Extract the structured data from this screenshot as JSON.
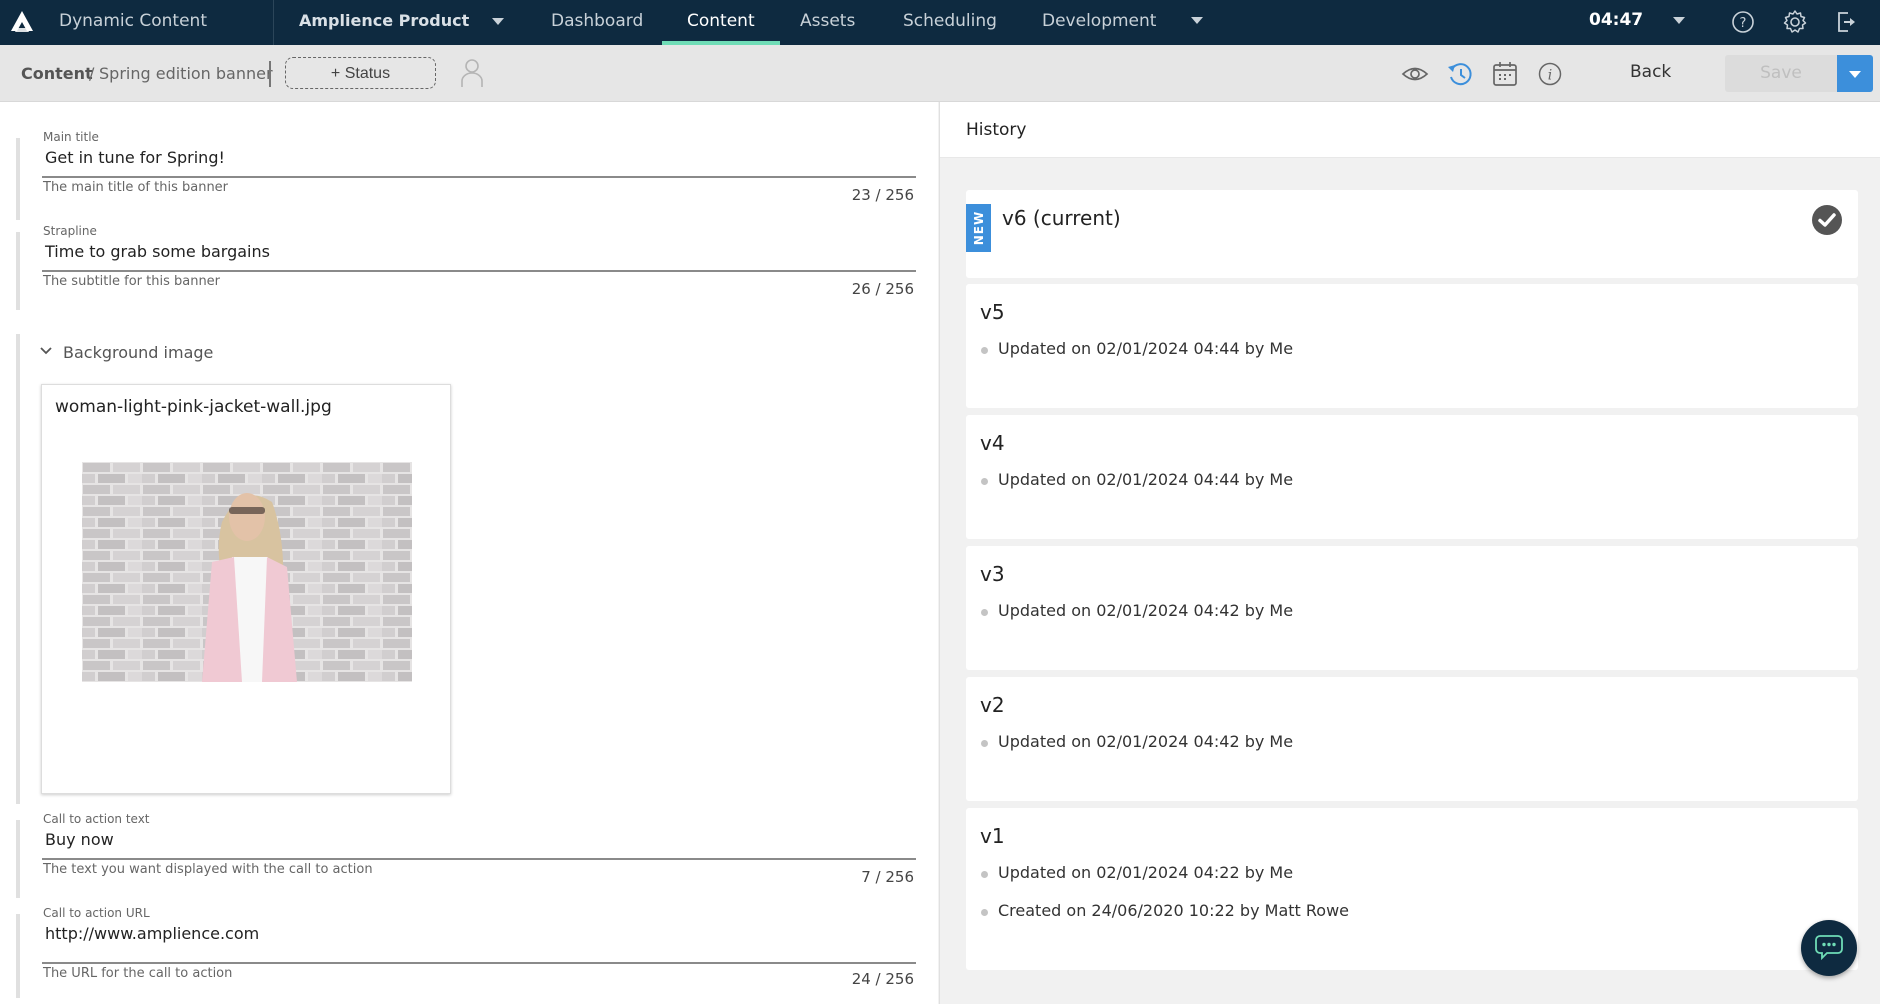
{
  "topnav": {
    "app_title": "Dynamic Content",
    "hub_name": "Amplience Product",
    "tabs": [
      {
        "label": "Dashboard",
        "active": false
      },
      {
        "label": "Content",
        "active": true
      },
      {
        "label": "Assets",
        "active": false
      },
      {
        "label": "Scheduling",
        "active": false
      },
      {
        "label": "Development",
        "active": false
      }
    ],
    "time": "04:47",
    "icons": [
      "help-icon",
      "settings-icon",
      "logout-icon"
    ],
    "accent_color": "#6fdcb6",
    "bg_color": "#0e2a40"
  },
  "toolbar": {
    "breadcrumb_root": "Content",
    "breadcrumb_sep": "/",
    "breadcrumb_current": "Spring edition banner",
    "status_label": "+ Status",
    "icons": [
      "preview-eye-icon",
      "history-icon",
      "calendar-icon",
      "info-icon"
    ],
    "active_icon": "history-icon",
    "back_label": "Back",
    "save_label": "Save",
    "save_enabled": false,
    "primary_color": "#3c8fdb"
  },
  "editor": {
    "fields": [
      {
        "label": "Main title",
        "value": "Get in tune for Spring!",
        "help": "The main title of this banner",
        "count": "23 / 256"
      },
      {
        "label": "Strapline",
        "value": "Time to grab some bargains",
        "help": "The subtitle for this banner",
        "count": "26 / 256"
      },
      {
        "label": "Call to action text",
        "value": "Buy now",
        "help": "The text you want displayed with the call to action",
        "count": "7 / 256"
      },
      {
        "label": "Call to action URL",
        "value": "http://www.amplience.com",
        "help": "The URL for the call to action",
        "count": "24 / 256"
      }
    ],
    "background_image": {
      "section_title": "Background image",
      "expanded": true,
      "file_name": "woman-light-pink-jacket-wall.jpg"
    }
  },
  "history": {
    "title": "History",
    "versions": [
      {
        "name": "v6 (current)",
        "badge": "NEW",
        "current": true,
        "entries": []
      },
      {
        "name": "v5",
        "entries": [
          "Updated on 02/01/2024 04:44 by Me"
        ]
      },
      {
        "name": "v4",
        "entries": [
          "Updated on 02/01/2024 04:44 by Me"
        ]
      },
      {
        "name": "v3",
        "entries": [
          "Updated on 02/01/2024 04:42 by Me"
        ]
      },
      {
        "name": "v2",
        "entries": [
          "Updated on 02/01/2024 04:42 by Me"
        ]
      },
      {
        "name": "v1",
        "entries": [
          "Updated on 02/01/2024 04:22 by Me",
          "Created on 24/06/2020 10:22 by Matt Rowe"
        ]
      }
    ]
  },
  "chat": {
    "icon": "chat-bubble-icon"
  }
}
